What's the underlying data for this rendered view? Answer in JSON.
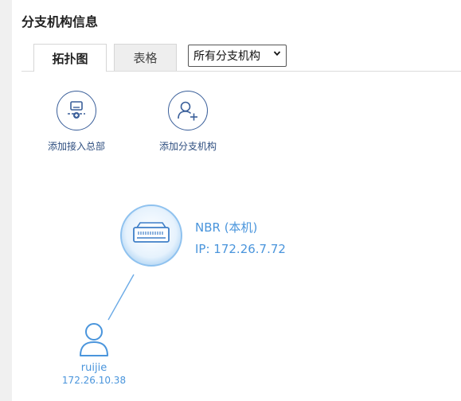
{
  "page": {
    "title": "分支机构信息"
  },
  "tabs": [
    {
      "label": "拓扑图",
      "active": true
    },
    {
      "label": "表格",
      "active": false
    }
  ],
  "filter": {
    "selected": "所有分支机构"
  },
  "actions": [
    {
      "label": "添加接入总部",
      "icon": "add-hq-device-icon"
    },
    {
      "label": "添加分支机构",
      "icon": "add-branch-user-icon"
    }
  ],
  "topology": {
    "router": {
      "name": "NBR (本机)",
      "ip": "IP: 172.26.7.72",
      "icon": "router-icon"
    },
    "branch": {
      "name": "ruijie",
      "ip": "172.26.10.38",
      "icon": "user-icon"
    }
  },
  "colors": {
    "accent": "#4a95dc",
    "action": "#3a5f9a",
    "tab_inactive": "#eeeeee"
  }
}
